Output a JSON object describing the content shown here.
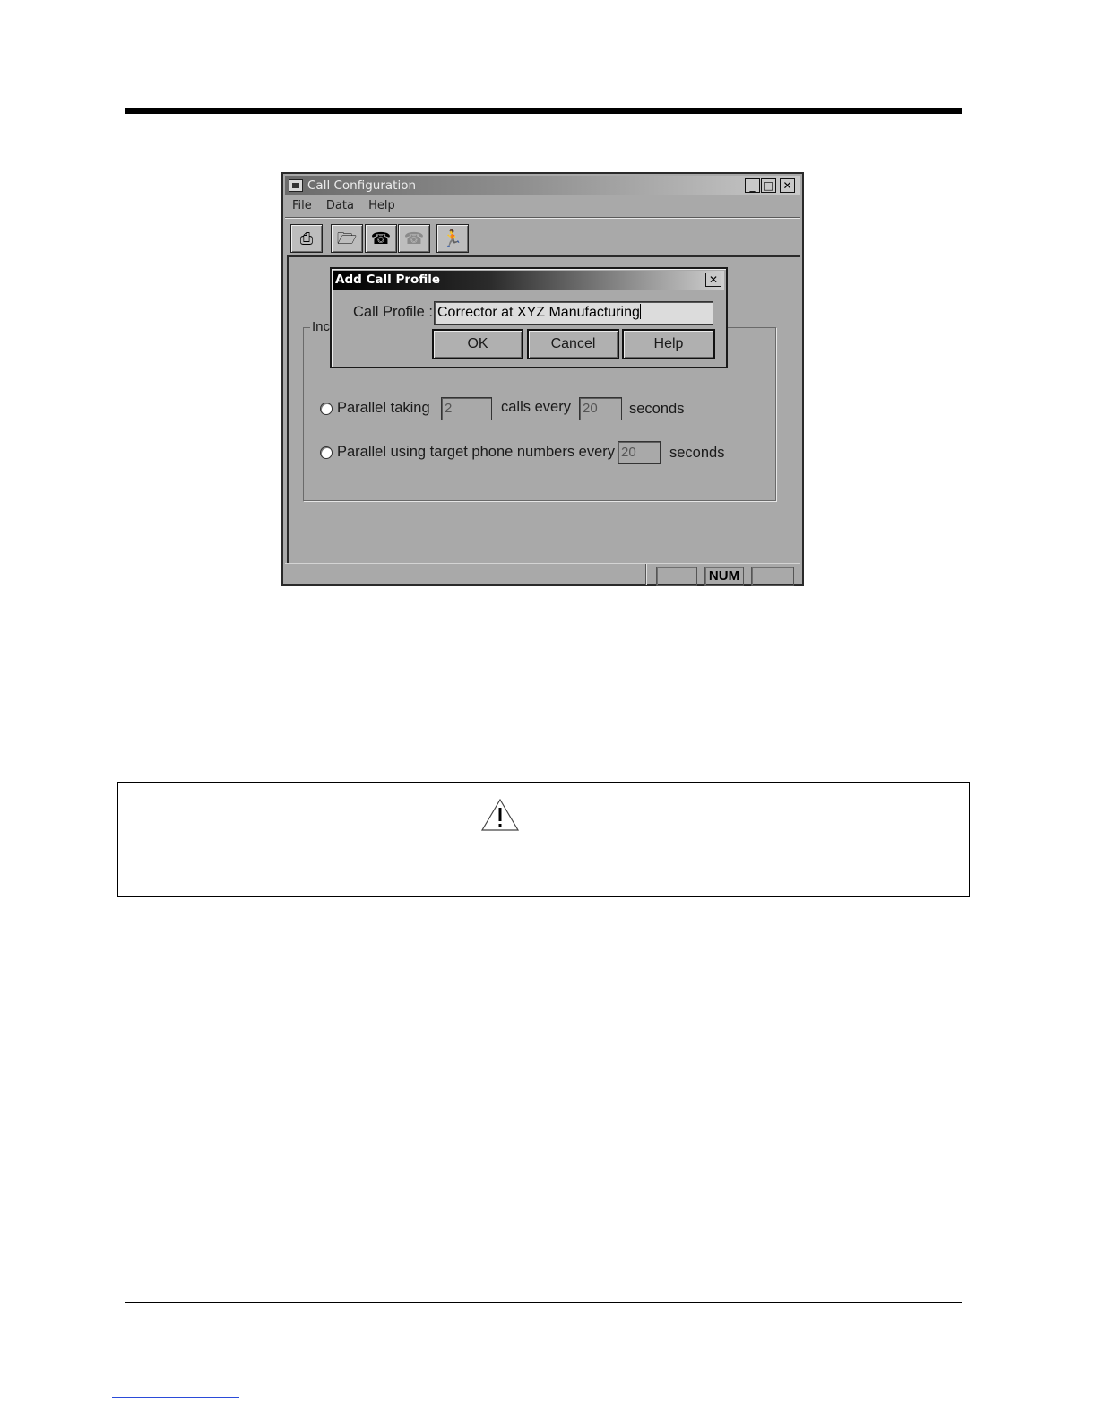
{
  "window": {
    "title": "Call Configuration",
    "menu": [
      "File",
      "Data",
      "Help"
    ],
    "toolbar": [
      {
        "icon": "printer-icon",
        "glyph": "⎙",
        "enabled": true
      },
      {
        "icon": "open-folder-icon",
        "glyph": "🗁",
        "enabled": true
      },
      {
        "icon": "phone-call-icon",
        "glyph": "☎",
        "enabled": true
      },
      {
        "icon": "phone-call-disabled-icon",
        "glyph": "☎",
        "enabled": false
      },
      {
        "icon": "running-man-icon",
        "glyph": "🏃",
        "enabled": true
      }
    ],
    "group_label": "Inc",
    "options": {
      "parallel_taking_label": "Parallel taking",
      "parallel_taking_calls": "2",
      "calls_every_label": "calls every",
      "parallel_taking_seconds": "20",
      "seconds_label": "seconds",
      "parallel_targets_label": "Parallel using target phone numbers every",
      "parallel_targets_seconds": "20",
      "seconds_label_2": "seconds"
    },
    "status": {
      "num": "NUM"
    }
  },
  "dialog": {
    "title": "Add Call Profile",
    "label": "Call Profile :",
    "value": "Corrector at XYZ Manufacturing",
    "ok": "OK",
    "cancel": "Cancel",
    "help": "Help"
  },
  "caution": {
    "icon": "warning-triangle-icon"
  }
}
